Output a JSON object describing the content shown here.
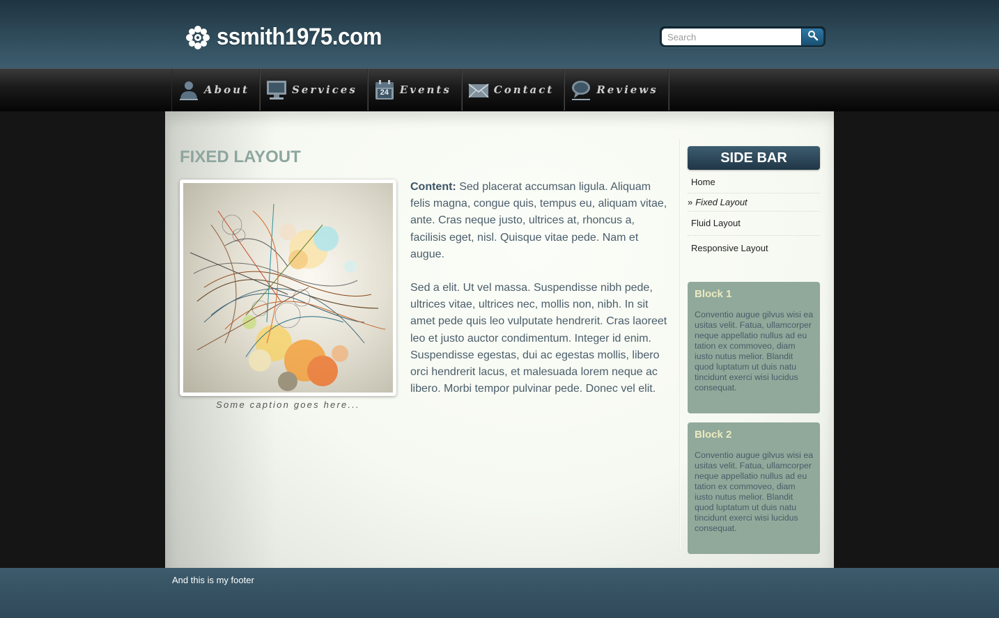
{
  "header": {
    "site_name": "ssmith1975.com",
    "logo_icon": "flower-icon",
    "search": {
      "placeholder": "Search",
      "button_icon": "search-icon"
    }
  },
  "nav": {
    "items": [
      {
        "label": "About",
        "icon": "user-icon"
      },
      {
        "label": "Services",
        "icon": "monitor-icon"
      },
      {
        "label": "Events",
        "icon": "calendar-icon",
        "icon_text": "24"
      },
      {
        "label": "Contact",
        "icon": "envelope-icon"
      },
      {
        "label": "Reviews",
        "icon": "speech-bubble-icon"
      }
    ]
  },
  "main": {
    "title": "FIXED LAYOUT",
    "caption": "Some caption goes here...",
    "content_lead": "Content:",
    "paragraph_1": "Sed placerat accumsan ligula. Aliquam felis magna, congue quis, tempus eu, aliquam vitae, ante. Cras neque justo, ultrices at, rhoncus a, facilisis eget, nisl. Quisque vitae pede. Nam et augue.",
    "paragraph_2": "Sed a elit. Ut vel massa. Suspendisse nibh pede, ultrices vitae, ultrices nec, mollis non, nibh. In sit amet pede quis leo vulputate hendrerit. Cras laoreet leo et justo auctor condimentum. Integer id enim. Suspendisse egestas, dui ac egestas mollis, libero orci hendrerit lacus, et malesuada lorem neque ac libero. Morbi tempor pulvinar pede. Donec vel elit."
  },
  "sidebar": {
    "title": "SIDE BAR",
    "active_marker": "»",
    "menu": [
      {
        "label": "Home"
      },
      {
        "label": "Fixed Layout",
        "active": true
      },
      {
        "label": "Fluid Layout"
      },
      {
        "label": "Responsive Layout"
      }
    ],
    "blocks": [
      {
        "title": "Block 1",
        "text": "Conventio augue gilvus wisi ea usitas velit. Fatua, ullamcorper neque appellatio nullus ad eu tation ex commoveo, diam iusto nutus melior. Blandit quod luptatum ut duis natu tincidunt exerci wisi lucidus consequat."
      },
      {
        "title": "Block 2",
        "text": "Conventio augue gilvus wisi ea usitas velit. Fatua, ullamcorper neque appellatio nullus ad eu tation ex commoveo, diam iusto nutus melior. Blandit quod luptatum ut duis natu tincidunt exerci wisi lucidus consequat."
      }
    ]
  },
  "footer": {
    "text": "And this is my footer"
  },
  "colors": {
    "header_bg": "#2e4a59",
    "title_green": "#8da69f",
    "block_bg": "#91a99b",
    "block_title": "#eceabf",
    "body_text": "#4a5d6a"
  }
}
